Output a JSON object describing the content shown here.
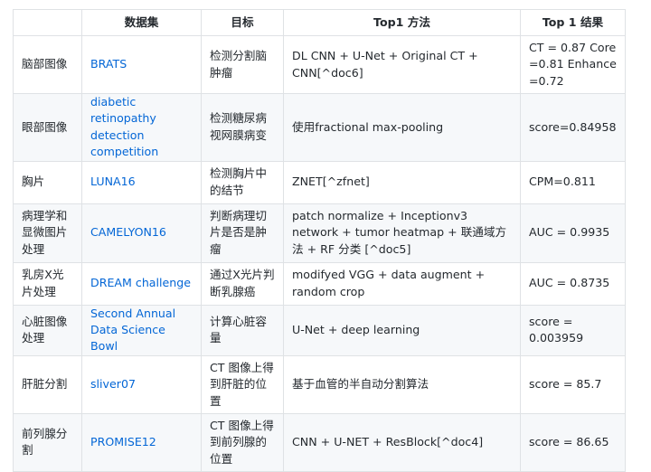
{
  "headers": [
    "",
    "数据集",
    "目标",
    "Top1 方法",
    "Top 1 结果"
  ],
  "rows": [
    {
      "area": "脑部图像",
      "dataset": "BRATS",
      "goal": "检测分割脑肿瘤",
      "method": "DL CNN + U-Net + Original CT + CNN[^doc6]",
      "result": "CT = 0.87 Core =0.81 Enhance =0.72"
    },
    {
      "area": "眼部图像",
      "dataset": "diabetic retinopathy detection competition",
      "goal": "检测糖尿病视网膜病变",
      "method": "使用fractional max-pooling",
      "result": "score=0.84958"
    },
    {
      "area": "胸片",
      "dataset": "LUNA16",
      "goal": "检测胸片中的结节",
      "method": "ZNET[^zfnet]",
      "result": "CPM=0.811"
    },
    {
      "area": "病理学和显微图片处理",
      "dataset": "CAMELYON16",
      "goal": "判断病理切片是否是肿瘤",
      "method": "patch normalize + Inceptionv3 network + tumor heatmap + 联通域方法 + RF 分类 [^doc5]",
      "result": "AUC = 0.9935"
    },
    {
      "area": "乳房X光片处理",
      "dataset": "DREAM challenge",
      "goal": "通过X光片判断乳腺癌",
      "method": "modifyed VGG + data augment + random crop",
      "result": "AUC = 0.8735"
    },
    {
      "area": "心脏图像处理",
      "dataset": "Second Annual Data Science Bowl",
      "goal": "计算心脏容量",
      "method": "U-Net + deep learning",
      "result": "score = 0.003959"
    },
    {
      "area": "肝脏分割",
      "dataset": "sliver07",
      "goal": "CT 图像上得到肝脏的位置",
      "method": "基于血管的半自动分割算法",
      "result": "score = 85.7"
    },
    {
      "area": "前列腺分割",
      "dataset": "PROMISE12",
      "goal": "CT 图像上得到前列腺的位置",
      "method": "CNN + U-NET + ResBlock[^doc4]",
      "result": "score = 86.65"
    }
  ]
}
